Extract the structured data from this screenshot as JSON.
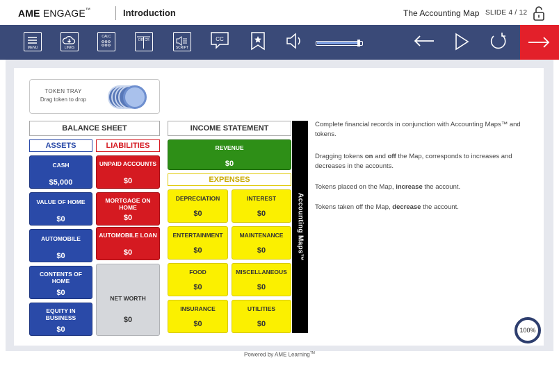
{
  "header": {
    "logo_bold": "AME",
    "logo_light": "ENGAGE",
    "logo_tm": "™",
    "title": "Introduction",
    "map_title": "The Accounting Map",
    "slide_indicator": "SLIDE 4 / 12"
  },
  "toolbar": {
    "menu_label": "MENU",
    "links_label": "LINKS",
    "calc_label": "CALC",
    "drcr_label": "DR CR",
    "script_label": "SCRIPT",
    "cc_label": "CC",
    "volume_level": 0.95
  },
  "token_tray": {
    "title": "TOKEN TRAY",
    "hint": "Drag token to drop"
  },
  "balance_sheet": {
    "title": "BALANCE SHEET",
    "assets_label": "ASSETS",
    "liabilities_label": "LIABILITIES",
    "assets": [
      {
        "label": "CASH",
        "amount": "$5,000"
      },
      {
        "label": "VALUE OF HOME",
        "amount": "$0"
      },
      {
        "label": "AUTOMOBILE",
        "amount": "$0"
      },
      {
        "label": "CONTENTS OF HOME",
        "amount": "$0"
      },
      {
        "label": "EQUITY IN BUSINESS",
        "amount": "$0"
      }
    ],
    "liabilities": [
      {
        "label": "UNPAID ACCOUNTS",
        "amount": "$0"
      },
      {
        "label": "MORTGAGE ON HOME",
        "amount": "$0"
      },
      {
        "label": "AUTOMOBILE LOAN",
        "amount": "$0"
      }
    ],
    "net_worth": {
      "label": "NET WORTH",
      "amount": "$0"
    }
  },
  "income_statement": {
    "title": "INCOME STATEMENT",
    "revenue": {
      "label": "REVENUE",
      "amount": "$0"
    },
    "expenses_label": "EXPENSES",
    "expenses": [
      {
        "label": "DEPRECIATION",
        "amount": "$0"
      },
      {
        "label": "INTEREST",
        "amount": "$0"
      },
      {
        "label": "ENTERTAINMENT",
        "amount": "$0"
      },
      {
        "label": "MAINTENANCE",
        "amount": "$0"
      },
      {
        "label": "FOOD",
        "amount": "$0"
      },
      {
        "label": "MISCELLANEOUS",
        "amount": "$0"
      },
      {
        "label": "INSURANCE",
        "amount": "$0"
      },
      {
        "label": "UTILITIES",
        "amount": "$0"
      }
    ]
  },
  "accounting_maps_label": "Accounting Maps™",
  "instructions": {
    "p1": "Complete financial records in conjunction with Accounting Maps™ and tokens.",
    "p2_a": "Dragging tokens ",
    "p2_on": "on",
    "p2_b": " and ",
    "p2_off": "off",
    "p2_c": " the Map, corresponds to increases and decreases in the accounts.",
    "p3_a": "Tokens placed on the Map, ",
    "p3_b": "increase",
    "p3_c": " the account.",
    "p4_a": "Tokens taken off the Map, ",
    "p4_b": "decrease",
    "p4_c": " the account."
  },
  "zoom_label": "100%",
  "footer": {
    "text": "Powered by AME Learning",
    "tm": "TM"
  },
  "colors": {
    "toolbar": "#3a4a78",
    "next_button": "#e3202a",
    "asset_blue": "#2a4aa8",
    "liability_red": "#d51a21",
    "revenue_green": "#2e8f17",
    "expense_yellow": "#fbf000"
  }
}
